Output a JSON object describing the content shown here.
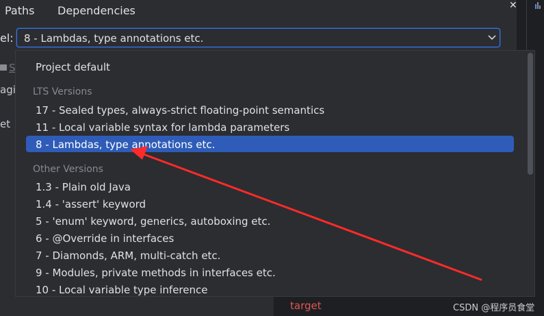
{
  "tabs": [
    {
      "label": "Paths"
    },
    {
      "label": "Dependencies"
    }
  ],
  "language_level": {
    "label_fragment": "el:",
    "current_value": "8 - Lambdas, type annotations etc."
  },
  "left_fragments": [
    "S",
    "agit",
    "et"
  ],
  "dropdown": {
    "default_item": "Project default",
    "groups": [
      {
        "title": "LTS Versions",
        "items": [
          "17 - Sealed types, always-strict floating-point semantics",
          "11 - Local variable syntax for lambda parameters",
          "8 - Lambdas, type annotations etc."
        ]
      },
      {
        "title": "Other Versions",
        "items": [
          "1.3 - Plain old Java",
          "1.4 - 'assert' keyword",
          "5 - 'enum' keyword, generics, autoboxing etc.",
          "6 - @Override in interfaces",
          "7 - Diamonds, ARM, multi-catch etc.",
          "9 - Modules, private methods in interfaces etc.",
          "10 - Local variable type inference"
        ]
      }
    ],
    "selected_item": "8 - Lambdas, type annotations etc."
  },
  "annotation": {
    "target_label": "target"
  },
  "watermark": "CSDN @程序员食堂",
  "colors": {
    "accent": "#3574f0",
    "selection": "#2e5cb8",
    "annotation_arrow": "#ff2a2a"
  },
  "icons": [
    "close-icon",
    "chevron-down-icon",
    "folder-icon",
    "arrow-annotation"
  ]
}
